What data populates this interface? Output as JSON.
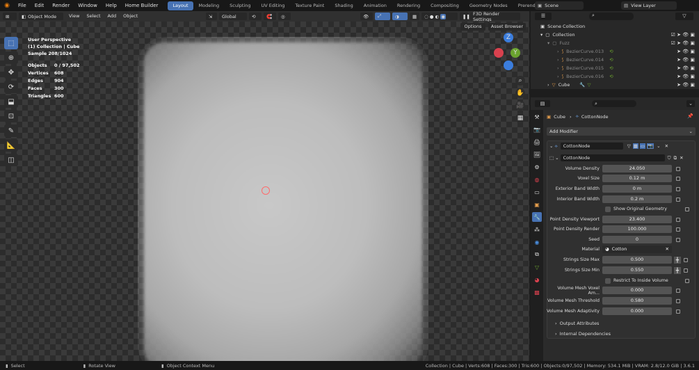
{
  "topbar": {
    "menus": [
      "File",
      "Edit",
      "Render",
      "Window",
      "Help",
      "Home Builder"
    ],
    "workspaces": [
      "Layout",
      "Modeling",
      "Sculpting",
      "UV Editing",
      "Texture Paint",
      "Shading",
      "Animation",
      "Rendering",
      "Compositing",
      "Geometry Nodes",
      "Prerendered View"
    ],
    "active_workspace": "Layout",
    "plus": "+",
    "scene": "Scene",
    "view_layer": "View Layer"
  },
  "viewport_header": {
    "mode": "Object Mode",
    "menus": [
      "View",
      "Select",
      "Add",
      "Object"
    ],
    "transform": "Global",
    "render_settings": "F3D Render Settings",
    "options": "Options",
    "asset_browser": "Asset Browser"
  },
  "overlay": {
    "view_name": "User Perspective",
    "collection": "(1) Collection | Cube",
    "sample": "Sample 208/1024",
    "stats": [
      {
        "k": "Objects",
        "v": "0 / 97,502"
      },
      {
        "k": "Vertices",
        "v": "608"
      },
      {
        "k": "Edges",
        "v": "904"
      },
      {
        "k": "Faces",
        "v": "300"
      },
      {
        "k": "Triangles",
        "v": "600"
      }
    ]
  },
  "outliner": {
    "search_placeholder": "",
    "scene_collection": "Scene Collection",
    "collection": "Collection",
    "fuzz": "Fuzz",
    "curves": [
      "BezierCurve.013",
      "BezierCurve.014",
      "BezierCurve.015",
      "BezierCurve.016"
    ],
    "cube": "Cube"
  },
  "properties": {
    "breadcrumb_object": "Cube",
    "breadcrumb_modifier": "CottonNode",
    "add_modifier": "Add Modifier",
    "modifier_name": "CottonNode",
    "node_group": "CottonNode",
    "fields": [
      {
        "label": "Volume Density",
        "value": "24.050"
      },
      {
        "label": "Voxel Size",
        "value": "0.12 m"
      },
      {
        "label": "Exterior Band Width",
        "value": "0 m"
      },
      {
        "label": "Interior Band Width",
        "value": "0.2 m"
      }
    ],
    "show_original_geometry": "Show Original Geometry",
    "fields2": [
      {
        "label": "Point Density Viewport",
        "value": "23.400"
      },
      {
        "label": "Point Density Render",
        "value": "100.000"
      },
      {
        "label": "Seed",
        "value": "0"
      }
    ],
    "material_label": "Material",
    "material_value": "Cotton",
    "fields3": [
      {
        "label": "Strings Size Max",
        "value": "0.500"
      },
      {
        "label": "Strings Size Min",
        "value": "0.550"
      }
    ],
    "restrict_inside": "Restrict To Inside Volume",
    "fields4": [
      {
        "label": "Volume Mesh Voxel Am...",
        "value": "0.000"
      },
      {
        "label": "Volume Mesh Threshold",
        "value": "0.580"
      },
      {
        "label": "Volume Mesh Adaptivity",
        "value": "0.000"
      }
    ],
    "output_attributes": "Output Attributes",
    "internal_dependencies": "Internal Dependencies"
  },
  "statusbar": {
    "select": "Select",
    "rotate_view": "Rotate View",
    "context_menu": "Object Context Menu",
    "info": "Collection | Cube | Verts:608 | Faces:300 | Tris:600 | Objects:0/97,502 | Memory: 534.1 MiB | VRAM: 2.8/12.0 GiB | 3.6.1"
  }
}
